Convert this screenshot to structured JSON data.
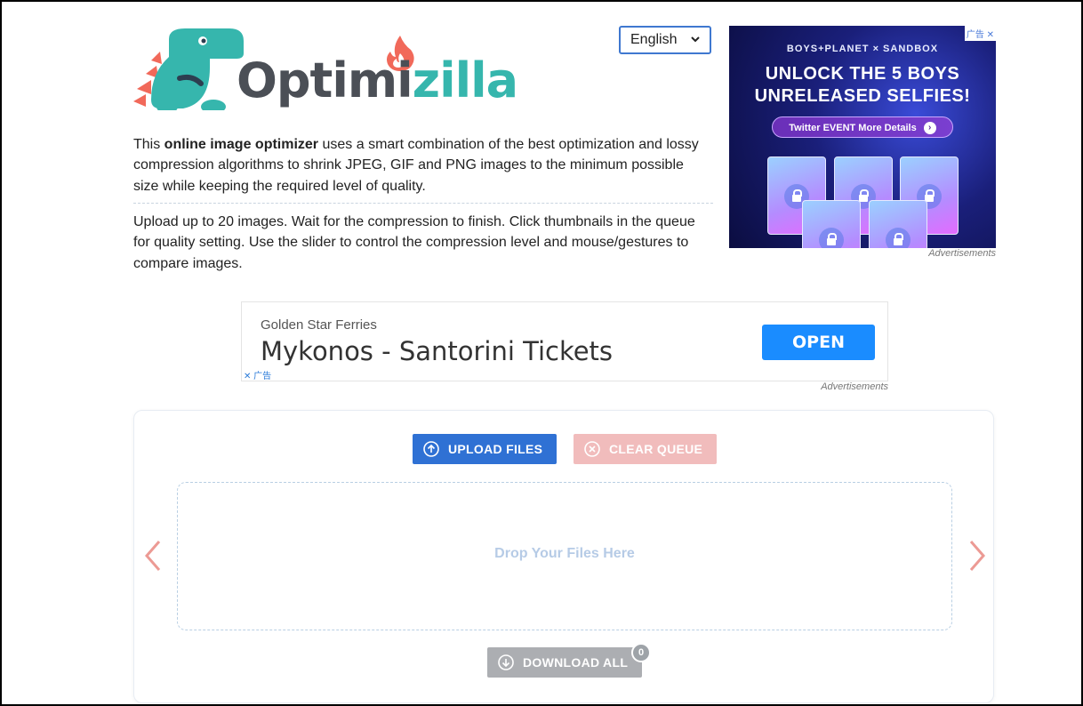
{
  "logo": {
    "part1": "Optimi",
    "part2": "zilla"
  },
  "language": {
    "selected": "English"
  },
  "intro": {
    "pre": "This ",
    "bold": "online image optimizer",
    "post": " uses a smart combination of the best optimization and lossy compression algorithms to shrink JPEG, GIF and PNG images to the minimum possible size while keeping the required level of quality.",
    "instructions": "Upload up to 20 images. Wait for the compression to finish. Click thumbnails in the queue for quality setting. Use the slider to control the compression level and mouse/gestures to compare images."
  },
  "ad_right": {
    "brand": "BOYS+PLANET × SANDBOX",
    "headline_1": "UNLOCK THE 5 BOYS",
    "headline_2": "UNRELEASED SELFIES!",
    "cta": "Twitter EVENT More Details",
    "tag": "广告",
    "label": "Advertisements"
  },
  "ad_mid": {
    "advertiser": "Golden Star Ferries",
    "title": "Mykonos - Santorini Tickets",
    "cta": "OPEN",
    "tag": "广告",
    "label": "Advertisements"
  },
  "uploader": {
    "upload_label": "UPLOAD FILES",
    "clear_label": "CLEAR QUEUE",
    "drop_text": "Drop Your Files Here",
    "download_label": "DOWNLOAD ALL",
    "download_count": "0"
  },
  "colors": {
    "upload": "#2f71d4",
    "clear": "#f1bcbc",
    "download": "#acaeb2",
    "logo_teal": "#36b6ad",
    "logo_dark": "#4b4f56"
  }
}
